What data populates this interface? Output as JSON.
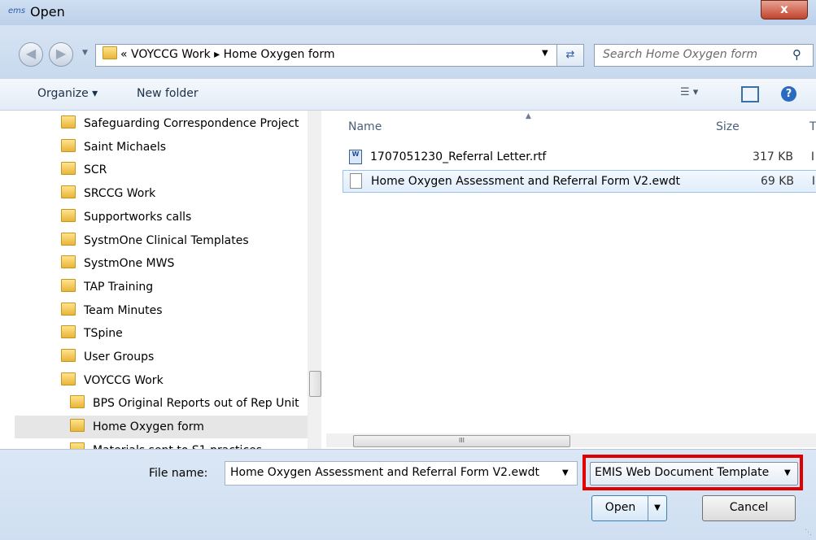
{
  "window": {
    "title": "Open",
    "app_icon_text": "ems",
    "close_glyph": "x"
  },
  "nav": {
    "back_icon": "arrow-left-icon",
    "forward_icon": "arrow-right-icon",
    "address": "« VOYCCG Work ▸ Home Oxygen form",
    "search_placeholder": "Search Home Oxygen form"
  },
  "toolbar": {
    "organize_label": "Organize ▾",
    "new_folder_label": "New folder"
  },
  "tree": {
    "items": [
      {
        "label": "Safeguarding Correspondence Project",
        "indent": 0
      },
      {
        "label": "Saint Michaels",
        "indent": 0
      },
      {
        "label": "SCR",
        "indent": 0
      },
      {
        "label": "SRCCG Work",
        "indent": 0
      },
      {
        "label": "Supportworks calls",
        "indent": 0
      },
      {
        "label": "SystmOne Clinical Templates",
        "indent": 0
      },
      {
        "label": "SystmOne MWS",
        "indent": 0
      },
      {
        "label": "TAP Training",
        "indent": 0
      },
      {
        "label": "Team Minutes",
        "indent": 0
      },
      {
        "label": "TSpine",
        "indent": 0
      },
      {
        "label": "User Groups",
        "indent": 0
      },
      {
        "label": "VOYCCG Work",
        "indent": 0
      },
      {
        "label": "BPS Original Reports out of Rep Unit",
        "indent": 1
      },
      {
        "label": "Home Oxygen form",
        "indent": 1,
        "selected": true
      },
      {
        "label": "Materials sent to S1 practices",
        "indent": 1
      }
    ]
  },
  "files": {
    "columns": {
      "name": "Name",
      "size": "Size",
      "extra": "T"
    },
    "rows": [
      {
        "name": "1707051230_Referral Letter.rtf",
        "size": "317 KB",
        "extra": "I",
        "icon": "word-doc-icon"
      },
      {
        "name": "Home Oxygen Assessment and Referral Form V2.ewdt",
        "size": "69 KB",
        "extra": "I",
        "icon": "blank-doc-icon",
        "selected": true
      }
    ],
    "hscroll_glyph": "III"
  },
  "bottom": {
    "file_name_label": "File name:",
    "file_name_value": "Home Oxygen Assessment and Referral Form V2.ewdt",
    "file_type_value": "EMIS Web Document Template",
    "open_label": "Open",
    "cancel_label": "Cancel"
  },
  "colors": {
    "highlight": "#e00000",
    "selection": "#e0edfb"
  }
}
